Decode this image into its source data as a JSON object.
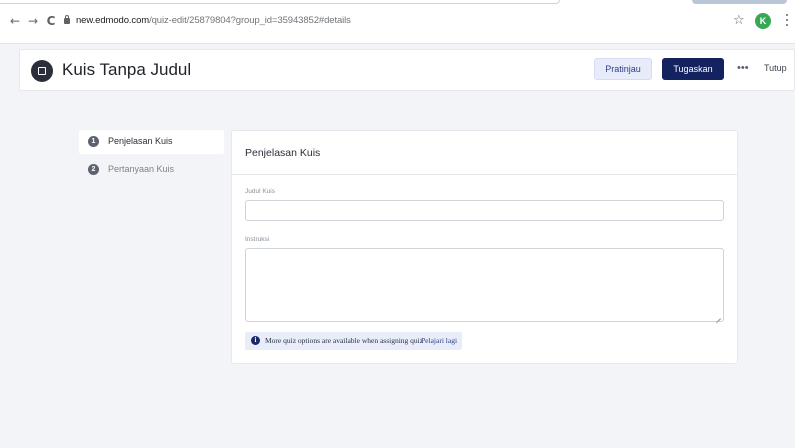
{
  "browser": {
    "url_domain": "new.edmodo.com",
    "url_path": "/quiz-edit/25879804?group_id=35943852#details",
    "back_glyph": "←",
    "forward_glyph": "→",
    "reload_glyph": "C",
    "star_glyph": "☆",
    "profile_initial": "K"
  },
  "header": {
    "title": "Kuis Tanpa Judul",
    "preview_label": "Pratinjau",
    "assign_label": "Tugaskan",
    "more_label": "•••",
    "close_label": "Tutup"
  },
  "steps": [
    {
      "number": "1",
      "label": "Penjelasan Kuis",
      "active": true
    },
    {
      "number": "2",
      "label": "Pertanyaan Kuis",
      "active": false
    }
  ],
  "card": {
    "title": "Penjelasan Kuis",
    "title_field_label": "Judul Kuis",
    "title_field_value": "",
    "instructions_label": "Instruksi",
    "instructions_value": "",
    "notice_icon": "i",
    "notice_text": "More quiz options are available when assigning quiz",
    "notice_link": "Pelajari lagi"
  },
  "colors": {
    "primary_button": "#142260",
    "secondary_button": "#e8ecfa",
    "background": "#f3f4f7",
    "profile": "#37a853"
  }
}
